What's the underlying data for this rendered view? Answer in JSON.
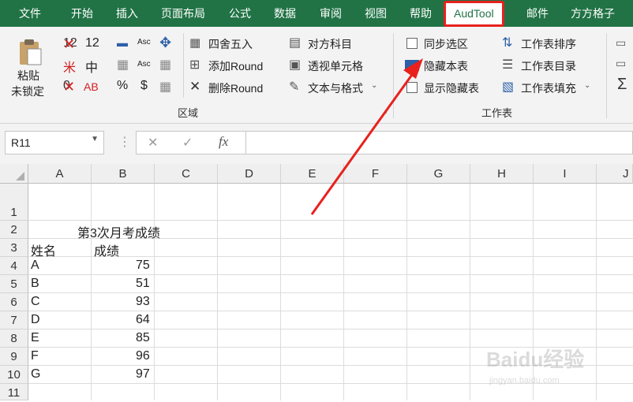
{
  "menu": {
    "tabs": [
      "文件",
      "开始",
      "插入",
      "页面布局",
      "公式",
      "数据",
      "审阅",
      "视图",
      "帮助",
      "AudTool",
      "邮件",
      "方方格子"
    ],
    "active_tab": "AudTool",
    "highlight_color": "#e8211d",
    "bar_color": "#217346"
  },
  "ribbon": {
    "paste_unlocked": {
      "line1": "粘贴",
      "line2": "未锁定"
    },
    "format_glyphs": {
      "r1": [
        "12",
        "12",
        "▬",
        "Asc",
        "✥"
      ],
      "r2": [
        "米",
        "中",
        "▦",
        "Asc",
        "▦"
      ],
      "r3": [
        "0",
        "AB",
        "%",
        "$",
        "▦"
      ]
    },
    "round_buttons": [
      "四舍五入",
      "添加Round",
      "删除Round"
    ],
    "subject_buttons": [
      "对方科目",
      "透视单元格",
      "文本与格式"
    ],
    "region_group_label": "区域",
    "sheet_checks": [
      "同步选区",
      "隐藏本表",
      "显示隐藏表"
    ],
    "sheet_buttons": [
      "工作表排序",
      "工作表目录",
      "工作表填充"
    ],
    "sheet_group_label": "工作表"
  },
  "formula_bar": {
    "name_box": "R11",
    "cancel_icon": "✕",
    "enter_icon": "✓",
    "fx_label": "fx",
    "formula": ""
  },
  "sheet": {
    "columns": [
      "A",
      "B",
      "C",
      "D",
      "E",
      "F",
      "G",
      "H",
      "I",
      "J"
    ],
    "rows": [
      "1",
      "2",
      "3",
      "4",
      "5",
      "6",
      "7",
      "8",
      "9",
      "10",
      "11"
    ],
    "title": "第3次月考成绩",
    "header": {
      "name": "姓名",
      "score": "成绩"
    },
    "records": [
      {
        "name": "A",
        "score": "75"
      },
      {
        "name": "B",
        "score": "51"
      },
      {
        "name": "C",
        "score": "93"
      },
      {
        "name": "D",
        "score": "64"
      },
      {
        "name": "E",
        "score": "85"
      },
      {
        "name": "F",
        "score": "96"
      },
      {
        "name": "G",
        "score": "97"
      }
    ]
  },
  "watermark": {
    "brand": "Baidu经验",
    "url": "jingyan.baidu.com"
  }
}
